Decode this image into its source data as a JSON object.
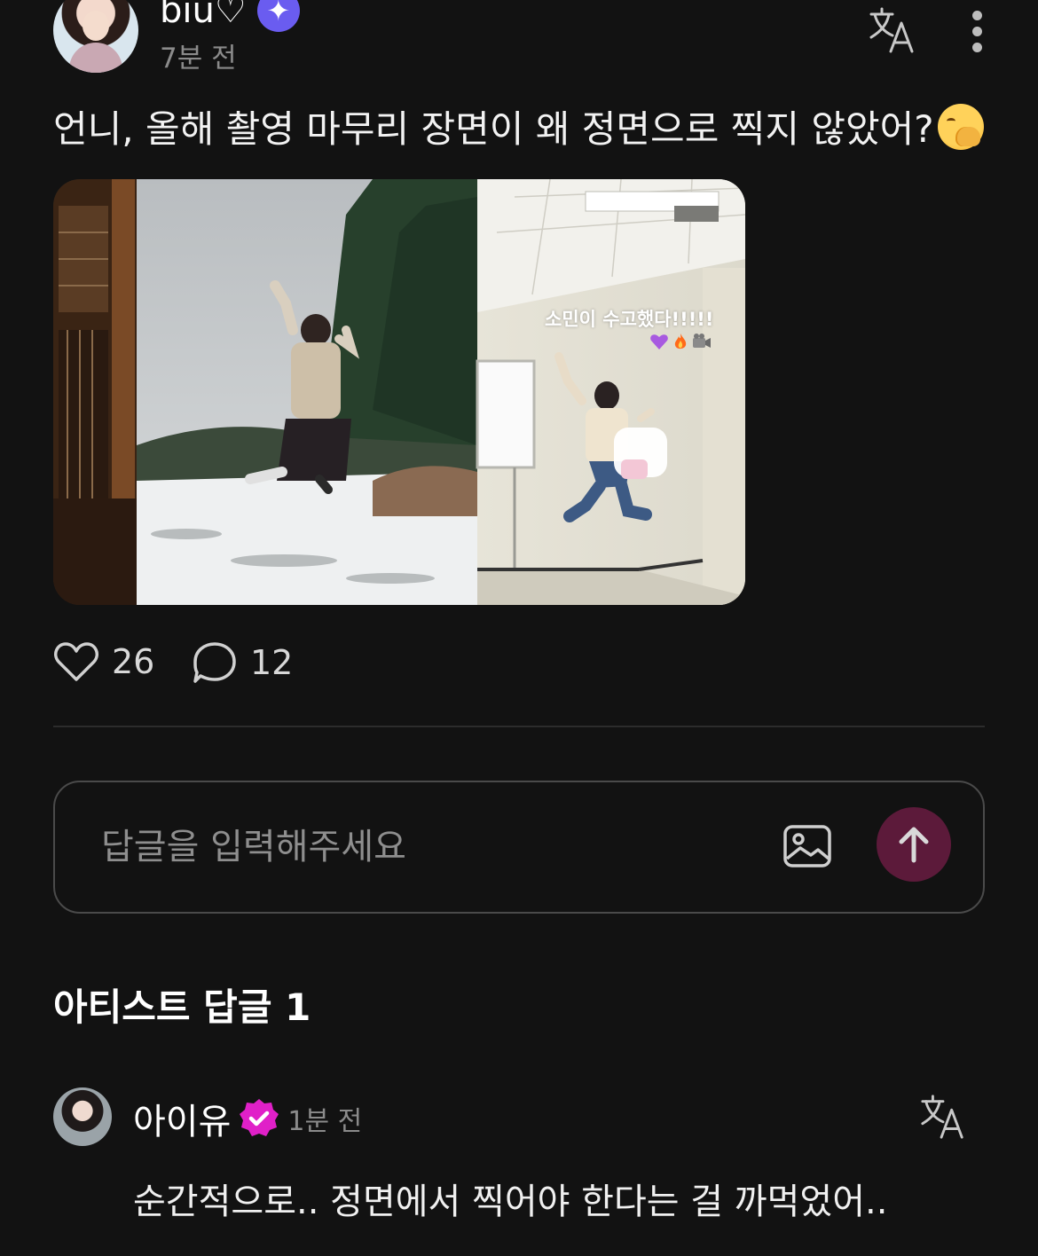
{
  "post": {
    "username": "biu♡",
    "time": "7분 전",
    "text": "언니, 올해 촬영 마무리 장면이 왜 정면으로 찍지 않았어?",
    "image_caption": "소민이 수고했다!!!!!",
    "likes": "26",
    "comments": "12"
  },
  "reply_input": {
    "placeholder": "답글을 입력해주세요"
  },
  "artist_replies": {
    "title": "아티스트 답글 1",
    "items": [
      {
        "author": "아이유",
        "time": "1분 전",
        "text": "순간적으로.. 정면에서 찍어야 한다는 걸 까먹었어.."
      }
    ]
  },
  "colors": {
    "background": "#121212",
    "accent_send": "#5c1a3a",
    "badge_star": "#6a5cf0",
    "verified_badge": "#e020c8",
    "muted_text": "#8b8b8b"
  },
  "icons": [
    "star-badge-icon",
    "translate-icon",
    "more-icon",
    "heart-icon",
    "comment-icon",
    "image-icon",
    "send-arrow-icon",
    "verified-badge-icon"
  ]
}
